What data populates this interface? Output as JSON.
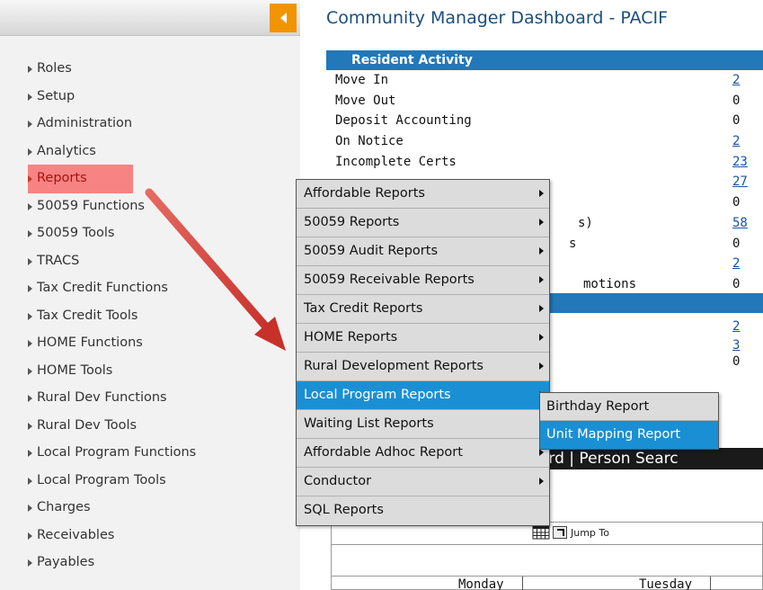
{
  "title": "Community Manager Dashboard - PACIF",
  "sidebar": {
    "items": [
      {
        "label": "Roles"
      },
      {
        "label": "Setup"
      },
      {
        "label": "Administration"
      },
      {
        "label": "Analytics"
      },
      {
        "label": "Reports"
      },
      {
        "label": "50059 Functions"
      },
      {
        "label": "50059 Tools"
      },
      {
        "label": "TRACS"
      },
      {
        "label": "Tax Credit Functions"
      },
      {
        "label": "Tax Credit Tools"
      },
      {
        "label": "HOME Functions"
      },
      {
        "label": "HOME Tools"
      },
      {
        "label": "Rural Dev Functions"
      },
      {
        "label": "Rural Dev Tools"
      },
      {
        "label": "Local Program Functions"
      },
      {
        "label": "Local Program Tools"
      },
      {
        "label": "Charges"
      },
      {
        "label": "Receivables"
      },
      {
        "label": "Payables"
      }
    ],
    "active_index": 4
  },
  "resident_activity": {
    "header": "Resident Activity",
    "rows": [
      {
        "label": "Move In",
        "value": "2",
        "link": true
      },
      {
        "label": "Move Out",
        "value": "0",
        "link": false
      },
      {
        "label": "Deposit Accounting",
        "value": "0",
        "link": false
      },
      {
        "label": "On Notice",
        "value": "2",
        "link": true
      },
      {
        "label": "Incomplete Certs",
        "value": "23",
        "link": true
      },
      {
        "label": "",
        "value": "27",
        "link": true
      },
      {
        "label": "",
        "value": "0",
        "link": false
      },
      {
        "label": "s)",
        "value": "58",
        "link": true
      },
      {
        "label": "s",
        "value": "0",
        "link": false
      },
      {
        "label": "",
        "value": "2",
        "link": true
      },
      {
        "label": "motions",
        "value": "0",
        "link": false
      }
    ]
  },
  "section2_rows": [
    {
      "value": "2",
      "link": true
    },
    {
      "value": "3",
      "link": true
    },
    {
      "value": "0",
      "link": false
    }
  ],
  "reports_menu": {
    "items": [
      {
        "label": "Affordable Reports"
      },
      {
        "label": "50059 Reports"
      },
      {
        "label": "50059 Audit Reports"
      },
      {
        "label": "50059 Receivable Reports"
      },
      {
        "label": "Tax Credit Reports"
      },
      {
        "label": "HOME Reports"
      },
      {
        "label": "Rural Development Reports"
      },
      {
        "label": "Local Program Reports"
      },
      {
        "label": "Waiting List Reports"
      },
      {
        "label": "Affordable Adhoc Report"
      },
      {
        "label": "Conductor"
      },
      {
        "label": "SQL Reports"
      }
    ],
    "selected_index": 7
  },
  "local_program_submenu": {
    "items": [
      {
        "label": "Birthday Report"
      },
      {
        "label": "Unit Mapping Report"
      }
    ],
    "selected_index": 1
  },
  "toolbar_strip": "ard  |  Person Searc",
  "jump_to": "Jump To",
  "calendar": {
    "days": [
      "Monday",
      "Tuesday"
    ]
  },
  "colors": {
    "accent_orange": "#f29400",
    "panel_blue": "#2278b9",
    "menu_selected": "#1b8fd4",
    "highlight": "#f78383",
    "arrow": "#d9463d"
  }
}
